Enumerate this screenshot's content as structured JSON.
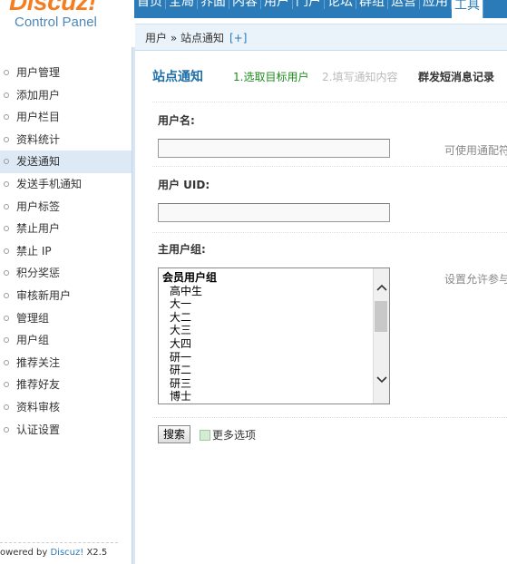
{
  "logo": {
    "wordmark": "Discuz!",
    "subtitle": "Control Panel"
  },
  "topnav": {
    "items": [
      "首页",
      "全局",
      "界面",
      "内容",
      "用户",
      "门户",
      "论坛",
      "群组",
      "运营",
      "应用",
      "工具"
    ],
    "active_index": 10
  },
  "breadcrumb": {
    "text": "用户 » 站点通知",
    "plus": "[+]"
  },
  "sidebar": {
    "items": [
      "用户管理",
      "添加用户",
      "用户栏目",
      "资料统计",
      "发送通知",
      "发送手机通知",
      "用户标签",
      "禁止用户",
      "禁止 IP",
      "积分奖惩",
      "审核新用户",
      "管理组",
      "用户组",
      "推荐关注",
      "推荐好友",
      "资料审核",
      "认证设置"
    ],
    "active_index": 4
  },
  "footer": {
    "prefix": "owered by ",
    "brand": "Discuz!",
    "version": " X2.5"
  },
  "main": {
    "title": "站点通知",
    "step1": "1.选取目标用户",
    "step2": "2.填写通知内容",
    "bulk_link": "群发短消息记录",
    "username_label": "用户名:",
    "username_value": "",
    "username_hint": "可使用通配符",
    "uid_label": "用户 UID:",
    "uid_value": "",
    "group_label": "主用户组:",
    "group_hint": "设置允许参与",
    "group_list": {
      "group_header": "会员用户组",
      "options": [
        "高中生",
        "大一",
        "大二",
        "大三",
        "大四",
        "研一",
        "研二",
        "研三",
        "博士"
      ]
    },
    "search_button": "搜索",
    "more_options": "更多选项"
  }
}
